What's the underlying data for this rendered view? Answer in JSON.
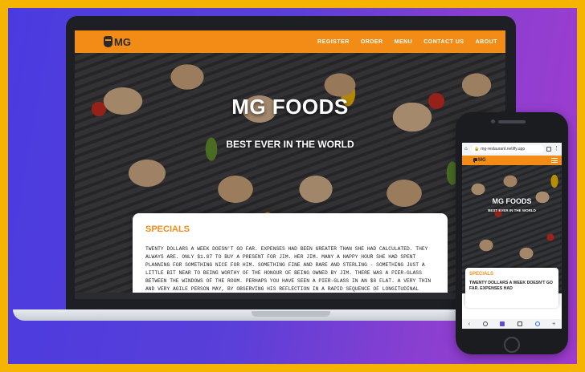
{
  "site": {
    "logo_text": "MG",
    "nav": [
      "REGISTER",
      "ORDER",
      "MENU",
      "CONTACT US",
      "ABOUT"
    ],
    "hero_title": "MG FOODS",
    "hero_subtitle": "BEST EVER IN THE WORLD",
    "specials_heading": "SPECIALS",
    "specials_text": "TWENTY DOLLARS A WEEK DOESN'T GO FAR. EXPENSES HAD BEEN GREATER THAN SHE HAD CALCULATED. THEY ALWAYS ARE. ONLY $1.87 TO BUY A PRESENT FOR JIM. HER JIM. MANY A HAPPY HOUR SHE HAD SPENT PLANNING FOR SOMETHING NICE FOR HIM. SOMETHING FINE AND RARE AND STERLING - SOMETHING JUST A LITTLE BIT NEAR TO BEING WORTHY OF THE HONOUR OF BEING OWNED BY JIM. THERE WAS A PIER-GLASS BETWEEN THE WINDOWS OF THE ROOM. PERHAPS YOU HAVE SEEN A PIER-GLASS IN AN $8 FLAT. A VERY THIN AND VERY AGILE PERSON MAY, BY OBSERVING HIS REFLECTION IN A RAPID SEQUENCE OF LONGITUDINAL STRIPS, OBTAIN A FAIRLY ACCURATE"
  },
  "mobile": {
    "url": "mg-restaurant.netlify.app",
    "logo_text": "MG",
    "hero_title": "MG FOODS",
    "hero_subtitle": "BEST EVER IN THE WORLD",
    "specials_heading": "SPECIALS",
    "specials_text": "TWENTY DOLLARS A WEEK DOESN'T GO FAR. EXPENSES HAD"
  },
  "colors": {
    "accent": "#f28c17",
    "frame": "#f5b400",
    "background_gradient": [
      "#4a3be0",
      "#a03ccf"
    ]
  }
}
